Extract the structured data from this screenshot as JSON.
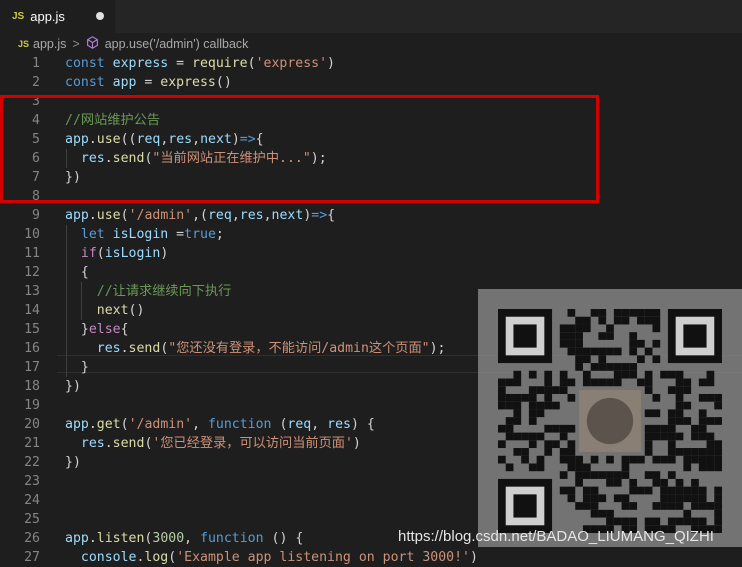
{
  "tab": {
    "icon": "JS",
    "filename": "app.js"
  },
  "breadcrumb": {
    "icon": "JS",
    "file": "app.js",
    "separator": ">",
    "symbol": "app.use('/admin') callback"
  },
  "lines": [
    {
      "n": "1",
      "t": [
        [
          "tk-kw",
          "const "
        ],
        [
          "tk-var",
          "express"
        ],
        [
          "tk-pun",
          " = "
        ],
        [
          "tk-fn",
          "require"
        ],
        [
          "tk-pun",
          "("
        ],
        [
          "tk-str",
          "'express'"
        ],
        [
          "tk-pun",
          ")"
        ]
      ]
    },
    {
      "n": "2",
      "t": [
        [
          "tk-kw",
          "const "
        ],
        [
          "tk-var",
          "app"
        ],
        [
          "tk-pun",
          " = "
        ],
        [
          "tk-fn",
          "express"
        ],
        [
          "tk-pun",
          "()"
        ]
      ]
    },
    {
      "n": "3",
      "t": []
    },
    {
      "n": "4",
      "t": [
        [
          "tk-cm",
          "//网站维护公告"
        ]
      ]
    },
    {
      "n": "5",
      "t": [
        [
          "tk-var",
          "app"
        ],
        [
          "tk-pun",
          "."
        ],
        [
          "tk-fn",
          "use"
        ],
        [
          "tk-pun",
          "(("
        ],
        [
          "tk-var",
          "req"
        ],
        [
          "tk-pun",
          ","
        ],
        [
          "tk-var",
          "res"
        ],
        [
          "tk-pun",
          ","
        ],
        [
          "tk-var",
          "next"
        ],
        [
          "tk-pun",
          ")"
        ],
        [
          "tk-kw",
          "=>"
        ],
        [
          "tk-pun",
          "{"
        ]
      ]
    },
    {
      "n": "6",
      "t": [
        [
          "tk-pun",
          "  "
        ],
        [
          "tk-var",
          "res"
        ],
        [
          "tk-pun",
          "."
        ],
        [
          "tk-fn",
          "send"
        ],
        [
          "tk-pun",
          "("
        ],
        [
          "tk-str",
          "\"当前网站正在维护中...\""
        ],
        [
          "tk-pun",
          ");"
        ]
      ]
    },
    {
      "n": "7",
      "t": [
        [
          "tk-pun",
          "})"
        ]
      ]
    },
    {
      "n": "8",
      "t": []
    },
    {
      "n": "9",
      "t": [
        [
          "tk-var",
          "app"
        ],
        [
          "tk-pun",
          "."
        ],
        [
          "tk-fn",
          "use"
        ],
        [
          "tk-pun",
          "("
        ],
        [
          "tk-str",
          "'/admin'"
        ],
        [
          "tk-pun",
          ",("
        ],
        [
          "tk-var",
          "req"
        ],
        [
          "tk-pun",
          ","
        ],
        [
          "tk-var",
          "res"
        ],
        [
          "tk-pun",
          ","
        ],
        [
          "tk-var",
          "next"
        ],
        [
          "tk-pun",
          ")"
        ],
        [
          "tk-kw",
          "=>"
        ],
        [
          "tk-pun",
          "{"
        ]
      ]
    },
    {
      "n": "10",
      "t": [
        [
          "tk-pun",
          "  "
        ],
        [
          "tk-kw",
          "let "
        ],
        [
          "tk-var",
          "isLogin"
        ],
        [
          "tk-pun",
          " ="
        ],
        [
          "tk-kw",
          "true"
        ],
        [
          "tk-pun",
          ";"
        ]
      ]
    },
    {
      "n": "11",
      "t": [
        [
          "tk-pun",
          "  "
        ],
        [
          "tk-ctrl",
          "if"
        ],
        [
          "tk-pun",
          "("
        ],
        [
          "tk-var",
          "isLogin"
        ],
        [
          "tk-pun",
          ")"
        ]
      ]
    },
    {
      "n": "12",
      "t": [
        [
          "tk-pun",
          "  {"
        ]
      ]
    },
    {
      "n": "13",
      "t": [
        [
          "tk-pun",
          "    "
        ],
        [
          "tk-cm",
          "//让请求继续向下执行"
        ]
      ]
    },
    {
      "n": "14",
      "t": [
        [
          "tk-pun",
          "    "
        ],
        [
          "tk-fn",
          "next"
        ],
        [
          "tk-pun",
          "()"
        ]
      ]
    },
    {
      "n": "15",
      "t": [
        [
          "tk-pun",
          "  }"
        ],
        [
          "tk-ctrl",
          "else"
        ],
        [
          "tk-pun",
          "{"
        ]
      ]
    },
    {
      "n": "16",
      "t": [
        [
          "tk-pun",
          "    "
        ],
        [
          "tk-var",
          "res"
        ],
        [
          "tk-pun",
          "."
        ],
        [
          "tk-fn",
          "send"
        ],
        [
          "tk-pun",
          "("
        ],
        [
          "tk-str",
          "\"您还没有登录，不能访问/admin这个页面\""
        ],
        [
          "tk-pun",
          ");"
        ]
      ]
    },
    {
      "n": "17",
      "t": [
        [
          "tk-pun",
          "  }"
        ]
      ]
    },
    {
      "n": "18",
      "t": [
        [
          "tk-pun",
          "})"
        ]
      ]
    },
    {
      "n": "19",
      "t": []
    },
    {
      "n": "20",
      "t": [
        [
          "tk-var",
          "app"
        ],
        [
          "tk-pun",
          "."
        ],
        [
          "tk-fn",
          "get"
        ],
        [
          "tk-pun",
          "("
        ],
        [
          "tk-str",
          "'/admin'"
        ],
        [
          "tk-pun",
          ", "
        ],
        [
          "tk-kw",
          "function"
        ],
        [
          "tk-pun",
          " ("
        ],
        [
          "tk-var",
          "req"
        ],
        [
          "tk-pun",
          ", "
        ],
        [
          "tk-var",
          "res"
        ],
        [
          "tk-pun",
          ") {"
        ]
      ]
    },
    {
      "n": "21",
      "t": [
        [
          "tk-pun",
          "  "
        ],
        [
          "tk-var",
          "res"
        ],
        [
          "tk-pun",
          "."
        ],
        [
          "tk-fn",
          "send"
        ],
        [
          "tk-pun",
          "("
        ],
        [
          "tk-str",
          "'您已经登录，可以访问当前页面'"
        ],
        [
          "tk-pun",
          ")"
        ]
      ]
    },
    {
      "n": "22",
      "t": [
        [
          "tk-pun",
          "})"
        ]
      ]
    },
    {
      "n": "23",
      "t": []
    },
    {
      "n": "24",
      "t": []
    },
    {
      "n": "25",
      "t": []
    },
    {
      "n": "26",
      "t": [
        [
          "tk-var",
          "app"
        ],
        [
          "tk-pun",
          "."
        ],
        [
          "tk-fn",
          "listen"
        ],
        [
          "tk-pun",
          "("
        ],
        [
          "tk-num",
          "3000"
        ],
        [
          "tk-pun",
          ", "
        ],
        [
          "tk-kw",
          "function"
        ],
        [
          "tk-pun",
          " () {"
        ]
      ]
    },
    {
      "n": "27",
      "t": [
        [
          "tk-pun",
          "  "
        ],
        [
          "tk-var",
          "console"
        ],
        [
          "tk-pun",
          "."
        ],
        [
          "tk-fn",
          "log"
        ],
        [
          "tk-pun",
          "("
        ],
        [
          "tk-str",
          "'Example app listening on port 3000!'"
        ],
        [
          "tk-pun",
          ")"
        ]
      ]
    }
  ],
  "watermark": "https://blog.csdn.net/BADAO_LIUMANG_QIZHI",
  "colors": {
    "highlight_box": "#d40000",
    "background": "#1e1e1e"
  }
}
